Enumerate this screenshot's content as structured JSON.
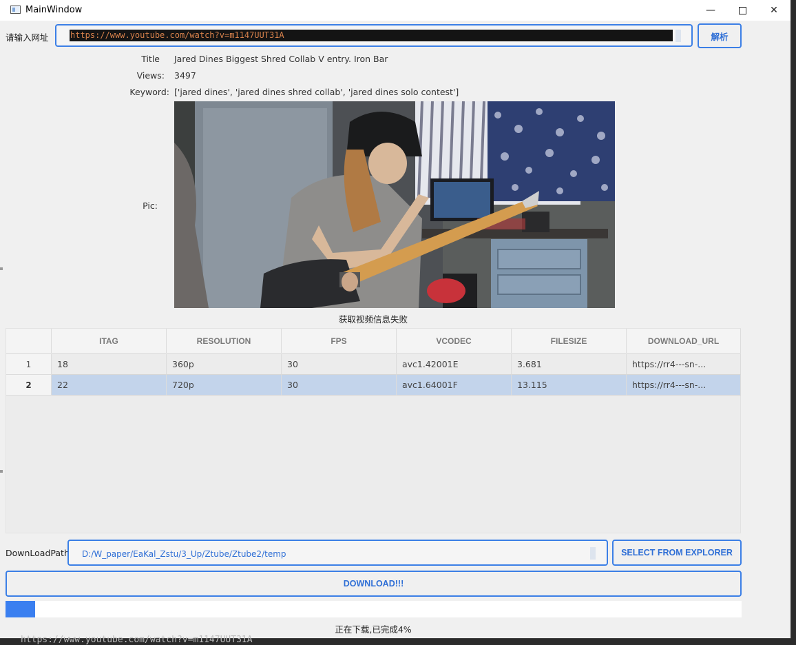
{
  "window": {
    "title": "MainWindow"
  },
  "url_row": {
    "label": "请输入网址",
    "value": "https://www.youtube.com/watch?v=m1147UUT31A",
    "parse_button": "解析"
  },
  "info": {
    "title_key": "Title",
    "title_value": "Jared Dines Biggest Shred Collab V entry. Iron Bar",
    "views_key": "Views:",
    "views_value": "3497",
    "keyword_key": "Keyword:",
    "keyword_value": "['jared dines', 'jared dines shred collab', 'jared dines solo contest']",
    "pic_key": "Pic:"
  },
  "status_top": "获取视频信息失败",
  "table": {
    "headers": [
      "ITAG",
      "RESOLUTION",
      "FPS",
      "VCODEC",
      "FILESIZE",
      "DOWNLOAD_URL"
    ],
    "rows": [
      {
        "num": "1",
        "cells": [
          "18",
          "360p",
          "30",
          "avc1.42001E",
          "3.681",
          "https://rr4---sn-..."
        ],
        "selected": false
      },
      {
        "num": "2",
        "cells": [
          "22",
          "720p",
          "30",
          "avc1.64001F",
          "13.115",
          "https://rr4---sn-..."
        ],
        "selected": true
      }
    ]
  },
  "download": {
    "path_label": "DownLoadPath",
    "path_value": "D:/W_paper/EaKal_Zstu/3_Up/Ztube/Ztube2/temp",
    "select_button": "SELECT FROM EXPLORER",
    "download_button": "DOWNLOAD!!!",
    "progress_percent": 4,
    "status": "正在下载,已完成4%"
  },
  "console_text": "https://www.youtube.com/watch?v=m1147UUT31A",
  "colors": {
    "accent": "#3b7fe6",
    "selection": "#c3d4eb",
    "progress": "#3a7ff0"
  }
}
